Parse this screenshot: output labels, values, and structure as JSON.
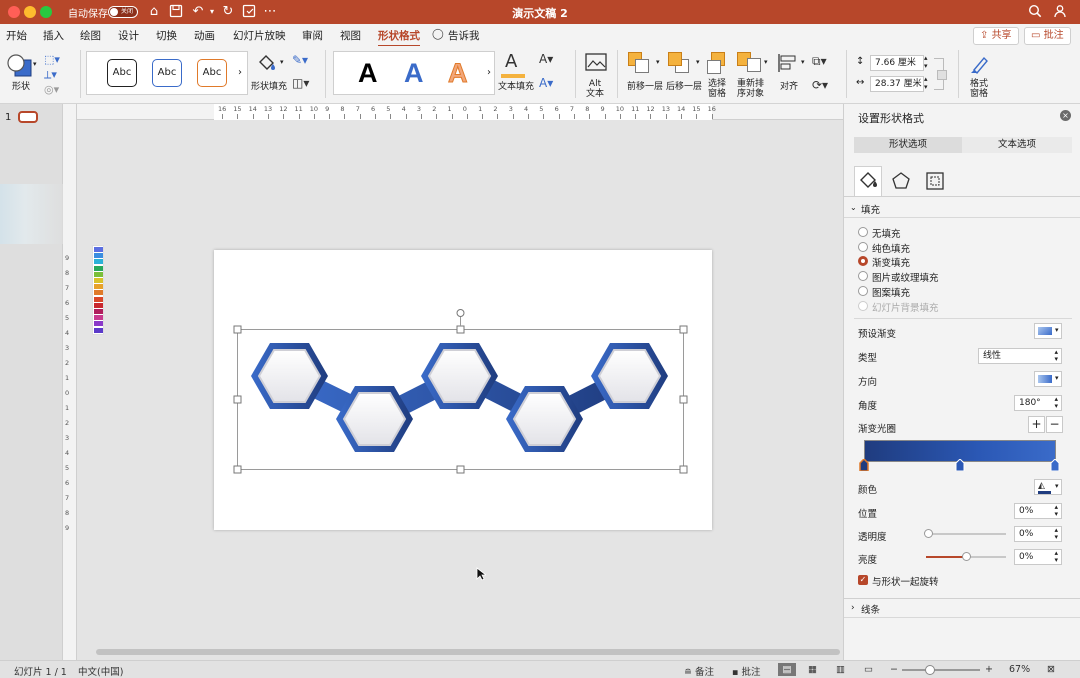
{
  "titlebar": {
    "autosave_label": "自动保存",
    "autosave_state": "关闭",
    "doc_title": "演示文稿 2"
  },
  "tabs": [
    "开始",
    "插入",
    "绘图",
    "设计",
    "切换",
    "动画",
    "幻灯片放映",
    "审阅",
    "视图",
    "形状格式"
  ],
  "tell_me": "告诉我",
  "share_label": "共享",
  "comment_label": "批注",
  "ribbon": {
    "shape_label": "形状",
    "style_sample": "Abc",
    "shape_fill_label": "形状填充",
    "wordart_sample": "A",
    "text_fill_label": "文本填充",
    "alt_text_label": "Alt\n文本",
    "bring_forward_label": "前移一层",
    "send_backward_label": "后移一层",
    "selection_pane_label": "选择\n窗格",
    "reorder_label": "重新排\n序对象",
    "align_label": "对齐",
    "height_value": "7.66 厘米",
    "width_value": "28.37 厘米",
    "format_pane_label": "格式\n窗格"
  },
  "slide_thumb_number": "1",
  "ruler_labels": [
    "16",
    "15",
    "14",
    "13",
    "12",
    "11",
    "10",
    "9",
    "8",
    "7",
    "6",
    "5",
    "4",
    "3",
    "2",
    "1",
    "0",
    "1",
    "2",
    "3",
    "4",
    "5",
    "6",
    "7",
    "8",
    "9",
    "10",
    "11",
    "12",
    "13",
    "14",
    "15",
    "16"
  ],
  "vruler_labels": [
    "9",
    "8",
    "7",
    "6",
    "5",
    "4",
    "3",
    "2",
    "1",
    "0",
    "1",
    "2",
    "3",
    "4",
    "5",
    "6",
    "7",
    "8",
    "9"
  ],
  "pane": {
    "title": "设置形状格式",
    "tab_shape": "形状选项",
    "tab_text": "文本选项",
    "fill_section": "填充",
    "fill_options": [
      "无填充",
      "纯色填充",
      "渐变填充",
      "图片或纹理填充",
      "图案填充",
      "幻灯片背景填充"
    ],
    "selected_fill": 2,
    "preset_label": "预设渐变",
    "type_label": "类型",
    "type_value": "线性",
    "direction_label": "方向",
    "angle_label": "角度",
    "angle_value": "180°",
    "stops_label": "渐变光圈",
    "color_label": "颜色",
    "position_label": "位置",
    "position_value": "0%",
    "transparency_label": "透明度",
    "transparency_value": "0%",
    "brightness_label": "亮度",
    "brightness_value": "0%",
    "rotate_label": "与形状一起旋转",
    "line_section": "线条"
  },
  "status": {
    "slide_count": "幻灯片 1 / 1",
    "language": "中文(中国)",
    "notes_label": "备注",
    "comments_label": "批注",
    "zoom": "67%"
  },
  "colors": {
    "accent": "#b7472a",
    "gradient_start": "#1f3c7f",
    "gradient_end": "#3a6bc9"
  },
  "palette_colors": [
    "#5b6ee1",
    "#3a8de0",
    "#2bb1d8",
    "#27a85a",
    "#7bbf3a",
    "#d9c22a",
    "#e8a22a",
    "#e07a2a",
    "#d9472a",
    "#c9282e",
    "#b01e5c",
    "#c93a8e",
    "#8a3ac9",
    "#5b3ac9"
  ]
}
